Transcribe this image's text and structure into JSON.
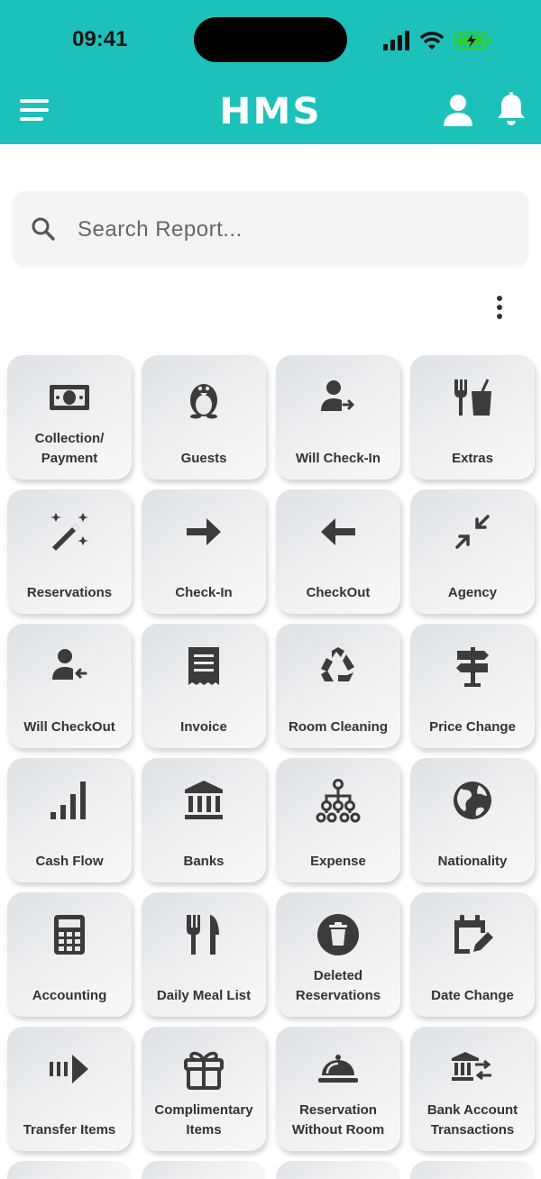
{
  "status_bar": {
    "time": "09:41"
  },
  "header": {
    "title": "HMS"
  },
  "search": {
    "placeholder": "Search Report..."
  },
  "colors": {
    "brand": "#1cc1ba",
    "icon": "#3b3b3b"
  },
  "tiles": [
    {
      "label": "Collection/\nPayment",
      "icon": "money-bill-icon"
    },
    {
      "label": "Guests",
      "icon": "penguin-icon"
    },
    {
      "label": "Will Check-In",
      "icon": "user-arrow-right-icon"
    },
    {
      "label": "Extras",
      "icon": "fork-drink-icon"
    },
    {
      "label": "Reservations",
      "icon": "magic-wand-icon"
    },
    {
      "label": "Check-In",
      "icon": "arrow-right-icon"
    },
    {
      "label": "CheckOut",
      "icon": "arrow-left-icon"
    },
    {
      "label": "Agency",
      "icon": "compress-arrows-icon"
    },
    {
      "label": "Will CheckOut",
      "icon": "user-arrow-left-icon"
    },
    {
      "label": "Invoice",
      "icon": "receipt-icon"
    },
    {
      "label": "Room Cleaning",
      "icon": "recycle-icon"
    },
    {
      "label": "Price Change",
      "icon": "signpost-icon"
    },
    {
      "label": "Cash Flow",
      "icon": "signal-bars-icon"
    },
    {
      "label": "Banks",
      "icon": "bank-icon"
    },
    {
      "label": "Expense",
      "icon": "sitemap-icon"
    },
    {
      "label": "Nationality",
      "icon": "globe-icon"
    },
    {
      "label": "Accounting",
      "icon": "calculator-icon"
    },
    {
      "label": "Daily Meal List",
      "icon": "utensils-icon"
    },
    {
      "label": "Deleted\nReservations",
      "icon": "trash-circle-icon"
    },
    {
      "label": "Date Change",
      "icon": "calendar-edit-icon"
    },
    {
      "label": "Transfer Items",
      "icon": "transfer-arrow-icon"
    },
    {
      "label": "Complimentary\nItems",
      "icon": "gift-icon"
    },
    {
      "label": "Reservation\nWithout Room",
      "icon": "room-service-icon"
    },
    {
      "label": "Bank Account\nTransactions",
      "icon": "bank-transfer-icon"
    }
  ]
}
